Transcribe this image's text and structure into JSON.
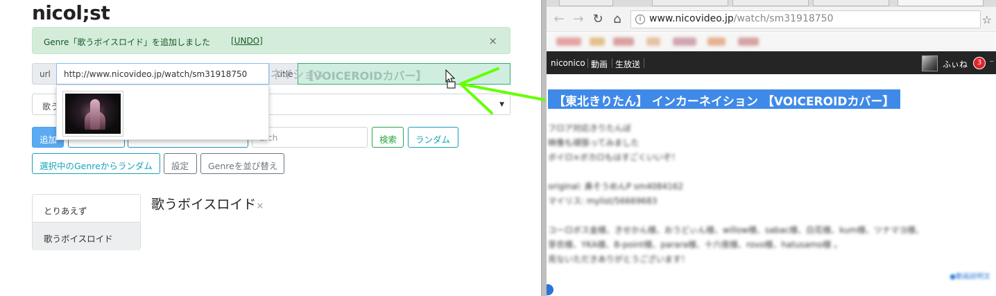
{
  "app": {
    "title": "nicol;st",
    "alert": {
      "message": "Genre「歌うボイスロイド」を追加しました",
      "undo": "[UNDO]",
      "close": "×"
    },
    "form": {
      "url_label": "url",
      "url_value": "http://www.nicovideo.jp/watch/sm31918750",
      "title_label": "title",
      "title_value": "【VOICEROIDカバー】",
      "drop_preview": "ネイション"
    },
    "select": {
      "value": "歌う",
      "caret": "▼"
    },
    "buttons": {
      "add": "追加",
      "search_placeholder": "arch",
      "search": "検索",
      "random": "ランダム",
      "genre_random": "選択中のGenreからランダム",
      "settings": "設定",
      "sort": "Genreを並び替え"
    },
    "genres": [
      "とりあえず",
      "歌うボイスロイド"
    ],
    "active_genre": "歌うボイスロイド",
    "genre_heading": "歌うボイスロイド",
    "genre_remove": "×"
  },
  "browser": {
    "url_host": "www.nicovideo.jp",
    "url_path": "/watch/sm31918750",
    "nav": {
      "back": "←",
      "forward": "→",
      "reload": "↻",
      "home": "⌂",
      "bookmark": "☆"
    },
    "site": {
      "links": [
        "niconico",
        "動画",
        "生放送"
      ],
      "user_name": "ふぃね",
      "notifications": "3"
    },
    "video_title": "【東北きりたん】 インカーネイション 【VOICEROIDカバー】",
    "description": {
      "lines": [
        "フロア対応きりたんぼ",
        "映像も頑張ってみました",
        "ボイロ×ボカロもはすごくいいぞ！",
        "",
        "original: 鼻そうめんP sm4084162",
        "マイリス: mylist/56669683",
        "",
        "コーロボス金様、きせかん様、おうどぃん様、willow様、sabac様、白花様、kum様、ツナマヨ様、",
        "芽衣様、YKA様、B-point様、parara様、十六夜様、rovo様、hatusamo様 。",
        "見ないただきありがとうございます！"
      ],
      "more": "●動画説明文"
    }
  },
  "colors": {
    "accent_blue": "#3f8ae8",
    "success_bg": "#d4edda",
    "arrow_green": "#66ff00",
    "nico_header": "#252525"
  }
}
